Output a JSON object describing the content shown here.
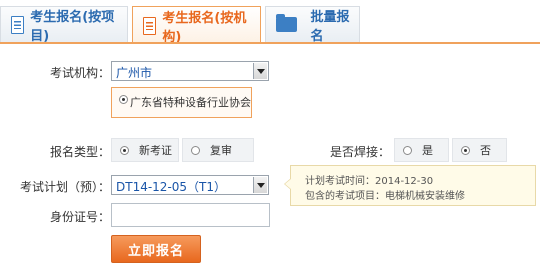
{
  "tabs": [
    {
      "label": "考生报名(按项目)",
      "icon": "document-icon"
    },
    {
      "label": "考生报名(按机构)",
      "icon": "document-icon",
      "active": true
    },
    {
      "label": "批量报名",
      "icon": "folder-icon"
    }
  ],
  "form": {
    "org_label": "考试机构：",
    "org_value": "广州市",
    "org_option": "广东省特种设备行业协会",
    "type_label": "报名类型：",
    "type_options": [
      "新考证",
      "复审"
    ],
    "weld_label": "是否焊接：",
    "weld_options": [
      "是",
      "否"
    ],
    "plan_label": "考试计划（预）：",
    "plan_value": "DT14-12-05（T1）",
    "id_label": "身份证号：",
    "id_value": "",
    "submit_label": "立即报名"
  },
  "tooltip": {
    "time_line": "计划考试时间：2014-12-30",
    "items_line": "包含的考试项目：电梯机械安装维修"
  },
  "colors": {
    "accent": "#e8681e",
    "link": "#2c6bb0"
  }
}
